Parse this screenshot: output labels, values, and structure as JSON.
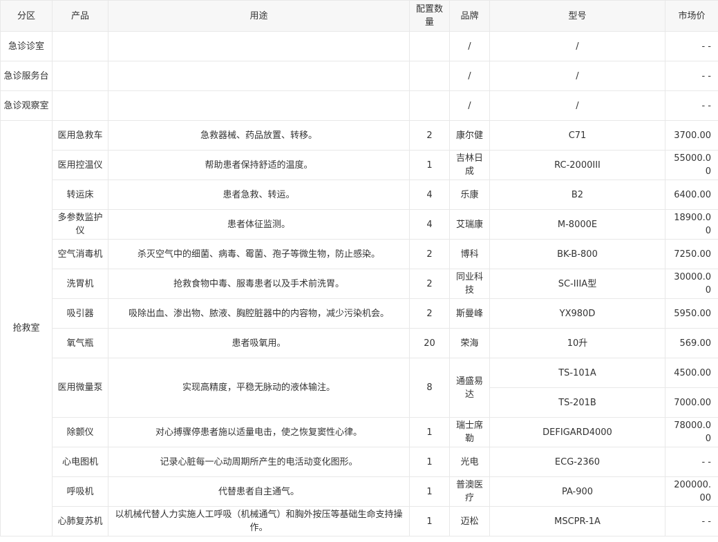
{
  "headers": [
    "分区",
    "产品",
    "用途",
    "配置数量",
    "品牌",
    "型号",
    "市场价"
  ],
  "simple_rows": [
    {
      "zone": "急诊诊室",
      "brand": "/",
      "model": "/",
      "price": "- -"
    },
    {
      "zone": "急诊服务台",
      "brand": "/",
      "model": "/",
      "price": "- -"
    },
    {
      "zone": "急诊观察室",
      "brand": "/",
      "model": "/",
      "price": "- -"
    }
  ],
  "rescue": {
    "zone": "抢救室",
    "rows": [
      {
        "product": "医用急救车",
        "use": "急救器械、药品放置、转移。",
        "qty": "2",
        "brand": "康尔健",
        "model": "C71",
        "price": "3700.00"
      },
      {
        "product": "医用控温仪",
        "use": "帮助患者保持舒适的温度。",
        "qty": "1",
        "brand": "吉林日成",
        "model": "RC-2000III",
        "price": "55000.00"
      },
      {
        "product": "转运床",
        "use": "患者急救、转运。",
        "qty": "4",
        "brand": "乐康",
        "model": "B2",
        "price": "6400.00"
      },
      {
        "product": "多参数监护仪",
        "use": "患者体征监测。",
        "qty": "4",
        "brand": "艾瑞康",
        "model": "M-8000E",
        "price": "18900.00"
      },
      {
        "product": "空气消毒机",
        "use": "杀灭空气中的细菌、病毒、霉菌、孢子等微生物，防止感染。",
        "qty": "2",
        "brand": "博科",
        "model": "BK-B-800",
        "price": "7250.00"
      },
      {
        "product": "洗胃机",
        "use": "抢救食物中毒、服毒患者以及手术前洗胃。",
        "qty": "2",
        "brand": "同业科技",
        "model": "SC-IIIA型",
        "price": "30000.00"
      },
      {
        "product": "吸引器",
        "use": "吸除出血、渗出物、脓液、胸腔脏器中的内容物，减少污染机会。",
        "qty": "2",
        "brand": "斯曼峰",
        "model": "YX980D",
        "price": "5950.00"
      },
      {
        "product": "氧气瓶",
        "use": "患者吸氧用。",
        "qty": "20",
        "brand": "荣海",
        "model": "10升",
        "price": "569.00"
      }
    ],
    "pump": {
      "product": "医用微量泵",
      "use": "实现高精度，平稳无脉动的液体输注。",
      "qty": "8",
      "brand": "通盛易达",
      "variants": [
        {
          "model": "TS-101A",
          "price": "4500.00"
        },
        {
          "model": "TS-201B",
          "price": "7000.00"
        }
      ]
    },
    "rows2": [
      {
        "product": "除颤仪",
        "use": "对心搏骤停患者施以适量电击，使之恢复窦性心律。",
        "qty": "1",
        "brand": "瑞士席勒",
        "model": "DEFIGARD4000",
        "price": "78000.00"
      },
      {
        "product": "心电图机",
        "use": "记录心脏每一心动周期所产生的电活动变化图形。",
        "qty": "1",
        "brand": "光电",
        "model": "ECG-2360",
        "price": "- -"
      },
      {
        "product": "呼吸机",
        "use": "代替患者自主通气。",
        "qty": "1",
        "brand": "普澳医疗",
        "model": "PA-900",
        "price": "200000.00"
      },
      {
        "product": "心肺复苏机",
        "use": "以机械代替人力实施人工呼吸（机械通气）和胸外按压等基础生命支持操作。",
        "qty": "1",
        "brand": "迈松",
        "model": "MSCPR-1A",
        "price": "- -"
      }
    ]
  }
}
